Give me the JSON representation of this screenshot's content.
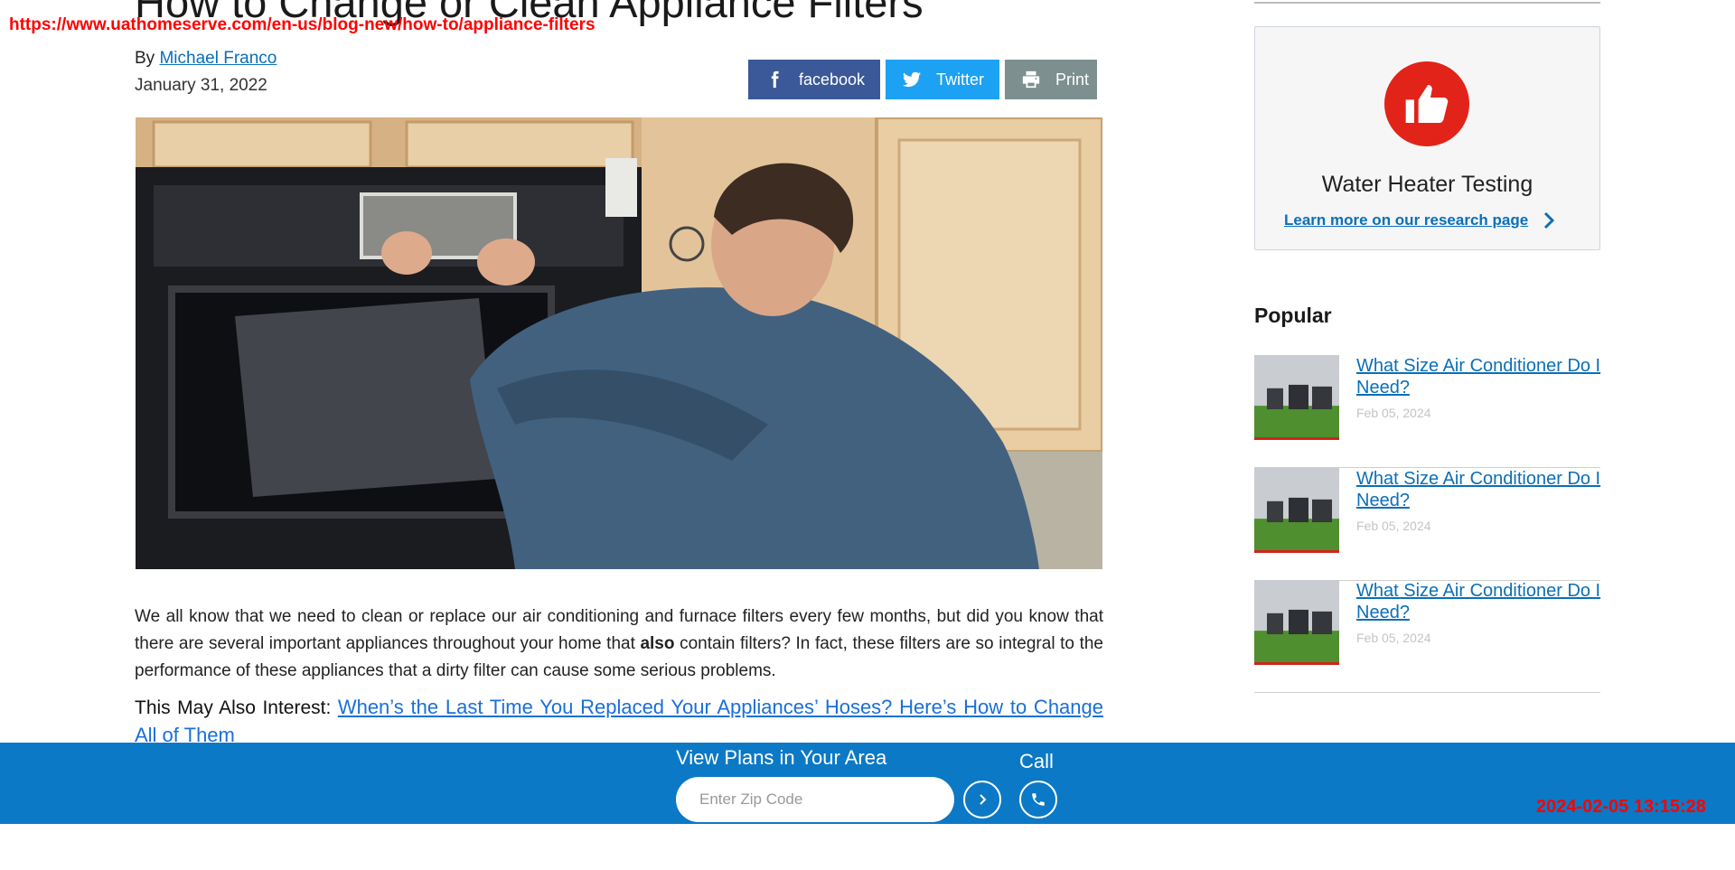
{
  "overlay": {
    "url": "https://www.uathomeserve.com/en-us/blog-new/how-to/appliance-filters",
    "timestamp": "2024-02-05 13:15:28"
  },
  "article": {
    "title": "How to Change or Clean Appliance Filters",
    "by_label": "By",
    "author": "Michael Franco",
    "date": "January 31, 2022",
    "image_alt": "Man replacing the filter of an over-the-range microwave",
    "body_part1": "We all know that we need to clean or replace our air conditioning and furnace filters every few months, but did you know that there are several important appliances throughout your home that ",
    "body_bold": "also",
    "body_part2": " contain filters? In fact, these filters are so integral to the performance of these appliances that a dirty filter can cause some serious problems.",
    "also_label": "This May Also Interest:",
    "also_link": "When’s the Last Time You Replaced Your Appliances’ Hoses? Here’s How to Change All of Them"
  },
  "share": {
    "facebook": "facebook",
    "twitter": "Twitter",
    "print": "Print"
  },
  "sidebar": {
    "cta": {
      "title": "Water Heater Testing",
      "link": "Learn more on our research page"
    },
    "popular_heading": "Popular",
    "popular": [
      {
        "title": "What Size Air Conditioner Do I Need?",
        "date": "Feb 05, 2024"
      },
      {
        "title": "What Size Air Conditioner Do I Need?",
        "date": "Feb 05, 2024"
      },
      {
        "title": "What Size Air Conditioner Do I Need?",
        "date": "Feb 05, 2024"
      }
    ]
  },
  "bottom_bar": {
    "plans_label": "View Plans in Your Area",
    "zip_placeholder": "Enter Zip Code",
    "call_label": "Call"
  },
  "colors": {
    "brand_blue": "#0b79c5",
    "link_blue": "#0b6fb8",
    "accent_red": "#e2231a",
    "facebook": "#3b5998",
    "twitter": "#1da1f2",
    "print": "#7d8f8f"
  }
}
